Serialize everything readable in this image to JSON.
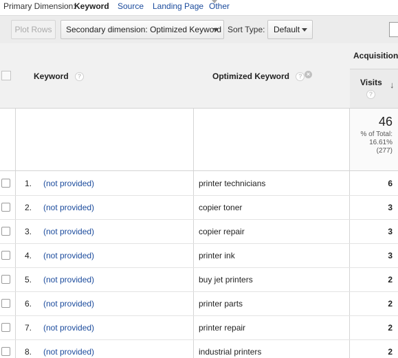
{
  "dimension_bar": {
    "label": "Primary Dimension:",
    "active": "Keyword",
    "links": [
      "Source",
      "Landing Page",
      "Other"
    ]
  },
  "toolbar": {
    "plot_rows": "Plot Rows",
    "secondary_dimension": "Secondary dimension: Optimized Keyword",
    "sort_type_label": "Sort Type:",
    "sort_type_value": "Default"
  },
  "table": {
    "headers": {
      "keyword": "Keyword",
      "optimized_keyword": "Optimized Keyword",
      "group": "Acquisition",
      "visits": "Visits",
      "help_glyph": "?",
      "remove_glyph": "×",
      "sort_glyph": "↓"
    },
    "totals": {
      "visits": "46",
      "pct_line1": "% of Total:",
      "pct_line2": "16.61%",
      "pct_line3": "(277)"
    },
    "rows": [
      {
        "num": "1.",
        "keyword": "(not provided)",
        "optimized": "printer technicians",
        "visits": "6"
      },
      {
        "num": "2.",
        "keyword": "(not provided)",
        "optimized": "copier toner",
        "visits": "3"
      },
      {
        "num": "3.",
        "keyword": "(not provided)",
        "optimized": "copier repair",
        "visits": "3"
      },
      {
        "num": "4.",
        "keyword": "(not provided)",
        "optimized": "printer ink",
        "visits": "3"
      },
      {
        "num": "5.",
        "keyword": "(not provided)",
        "optimized": "buy jet printers",
        "visits": "2"
      },
      {
        "num": "6.",
        "keyword": "(not provided)",
        "optimized": "printer parts",
        "visits": "2"
      },
      {
        "num": "7.",
        "keyword": "(not provided)",
        "optimized": "printer repair",
        "visits": "2"
      },
      {
        "num": "8.",
        "keyword": "(not provided)",
        "optimized": "industrial printers",
        "visits": "2"
      }
    ]
  },
  "colors": {
    "link": "#1a4a9c",
    "header_bg": "#f1f1f1",
    "sorted_column_bg": "#ebebeb"
  }
}
